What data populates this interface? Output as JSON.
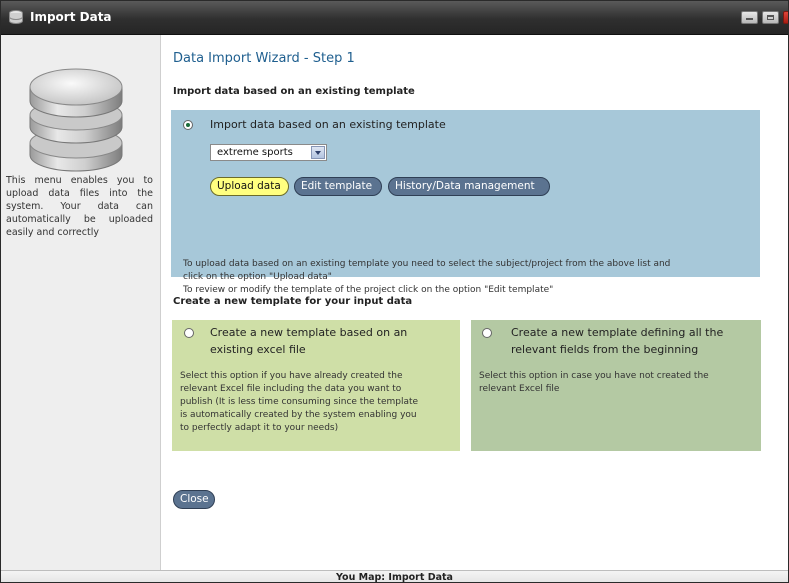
{
  "window": {
    "title": "Import Data"
  },
  "sidebar": {
    "description": "This menu enables you to upload data files into the system. Your data can automatically be uploaded easily and correctly"
  },
  "wizard": {
    "title": "Data Import Wizard - Step 1"
  },
  "existing": {
    "heading": "Import data based on an existing template",
    "option_label": "Import data based on an existing template",
    "selected_project": "extreme sports",
    "upload_label": "Upload data",
    "edit_label": "Edit template",
    "history_label": "History/Data management",
    "note_line1": "To upload data based on an existing template you need to select the subject/project from the above list and",
    "note_line2": "click on the option \"Upload data\"",
    "note_line3": "To review or modify the template of the project click on the option \"Edit template\""
  },
  "new_template": {
    "heading": "Create a new template for your input data",
    "excel": {
      "label_line1": "Create a new template based on an",
      "label_line2": "existing excel file",
      "desc_line1": "Select this option if you have already created the",
      "desc_line2": "relevant Excel file including the data you want to",
      "desc_line3": "publish (It is less time consuming since the template",
      "desc_line4": "is automatically created by the system enabling you",
      "desc_line5": "to perfectly adapt it to your needs)"
    },
    "scratch": {
      "label_line1": "Create a new template defining all the",
      "label_line2": "relevant fields from the beginning",
      "desc_line1": "Select this option in case you have not created the",
      "desc_line2": "relevant Excel file"
    }
  },
  "actions": {
    "close_label": "Close"
  },
  "footer": {
    "text": "You Map: Import Data"
  },
  "colors": {
    "blue_panel": "#a7c8d9",
    "green_left": "#cfdfa7",
    "green_right": "#b4c9a3",
    "title_blue": "#1f5f8f",
    "highlight_yellow": "#ffff80",
    "button_slate": "#5b7390"
  }
}
